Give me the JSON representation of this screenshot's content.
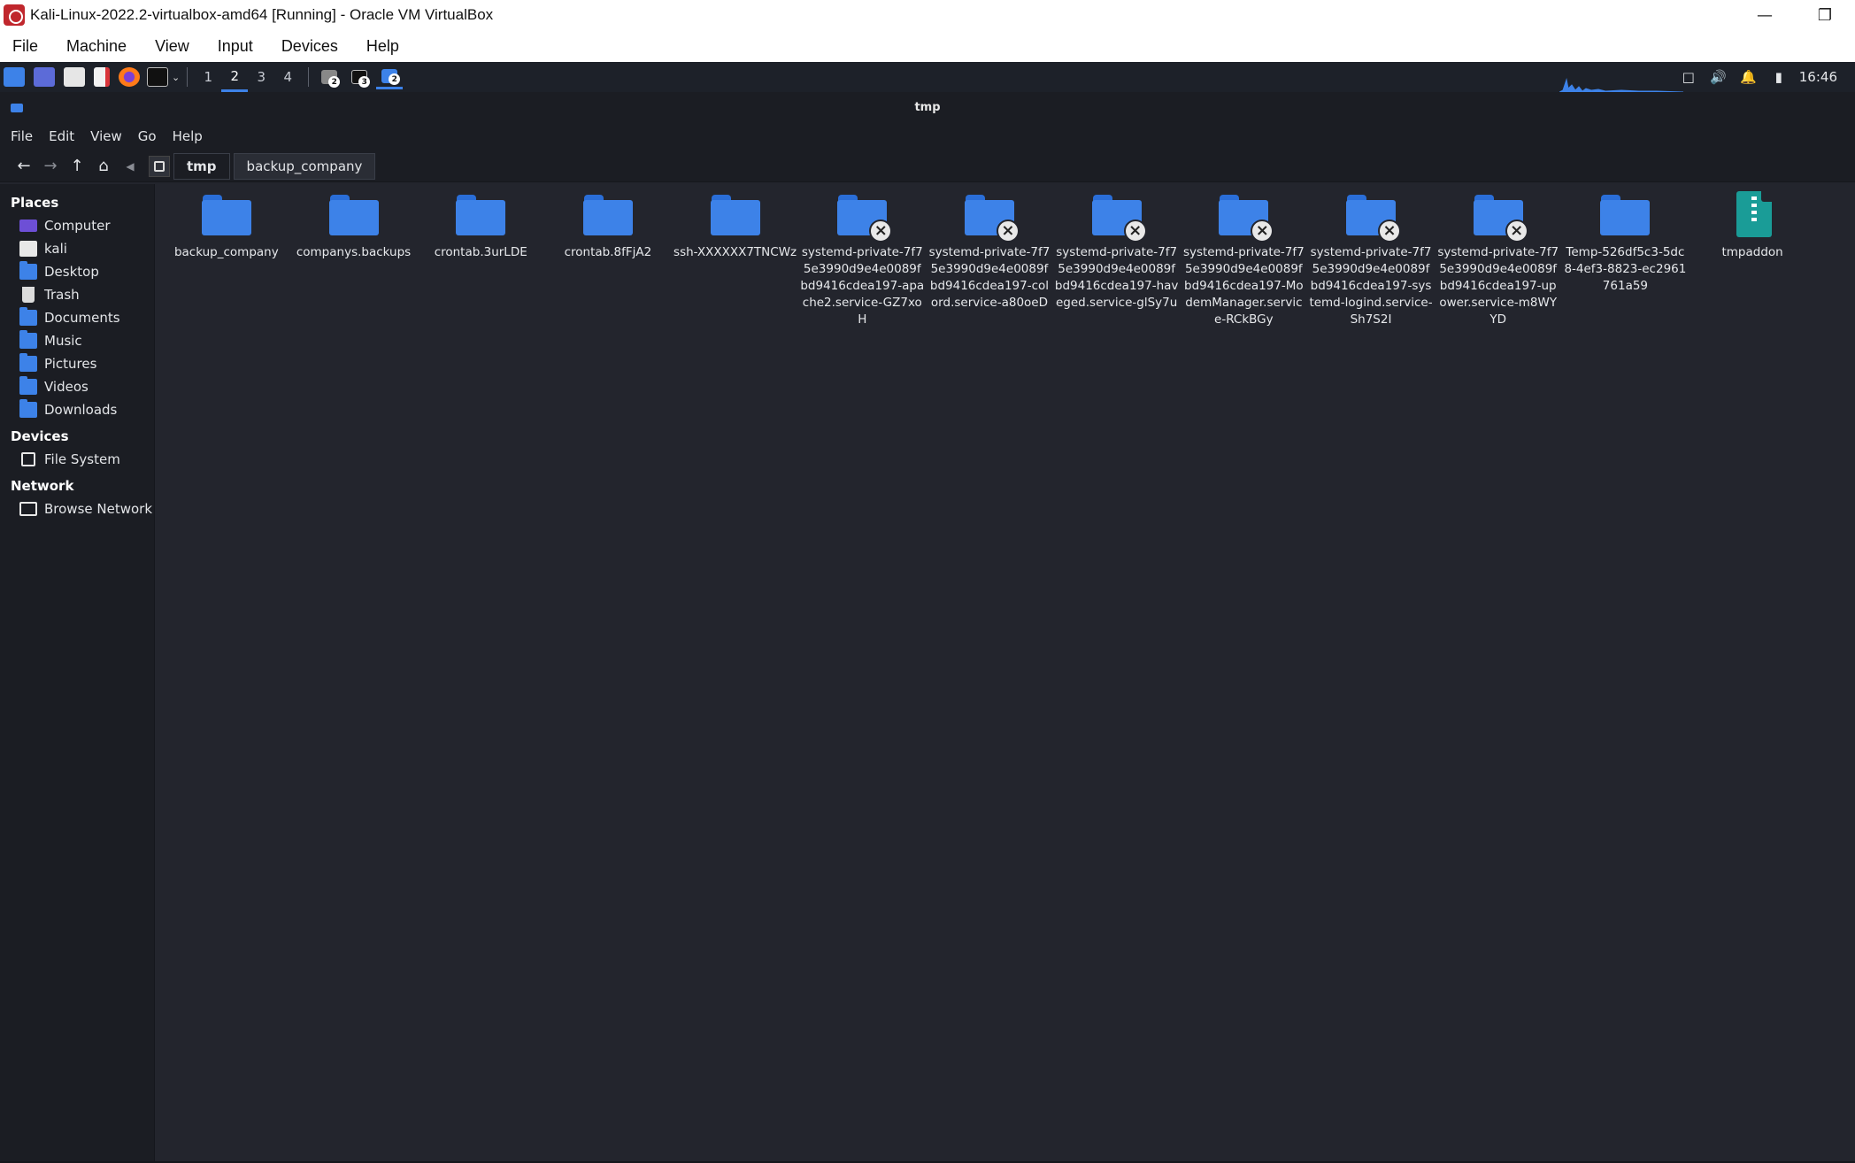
{
  "host": {
    "title": "Kali-Linux-2022.2-virtualbox-amd64 [Running] - Oracle VM VirtualBox",
    "menus": [
      "File",
      "Machine",
      "View",
      "Input",
      "Devices",
      "Help"
    ]
  },
  "panel": {
    "workspaces": [
      "1",
      "2",
      "3",
      "4"
    ],
    "active_workspace": "2",
    "task_badges": [
      "2",
      "3",
      "2"
    ],
    "clock": "16:46"
  },
  "window": {
    "title": "tmp",
    "menus": [
      "File",
      "Edit",
      "View",
      "Go",
      "Help"
    ],
    "breadcrumbs": [
      "tmp",
      "backup_company"
    ]
  },
  "sidebar": {
    "places_header": "Places",
    "places": [
      "Computer",
      "kali",
      "Desktop",
      "Trash",
      "Documents",
      "Music",
      "Pictures",
      "Videos",
      "Downloads"
    ],
    "devices_header": "Devices",
    "devices": [
      "File System"
    ],
    "network_header": "Network",
    "network": [
      "Browse Network"
    ]
  },
  "files": [
    {
      "name": "backup_company",
      "type": "folder"
    },
    {
      "name": "companys.backups",
      "type": "folder"
    },
    {
      "name": "crontab.3urLDE",
      "type": "folder"
    },
    {
      "name": "crontab.8fFjA2",
      "type": "folder"
    },
    {
      "name": "ssh-XXXXXX7TNCWz",
      "type": "folder"
    },
    {
      "name": "systemd-private-7f75e3990d9e4e0089fbd9416cdea197-apache2.service-GZ7xoH",
      "type": "folder-locked"
    },
    {
      "name": "systemd-private-7f75e3990d9e4e0089fbd9416cdea197-colord.service-a80oeD",
      "type": "folder-locked"
    },
    {
      "name": "systemd-private-7f75e3990d9e4e0089fbd9416cdea197-haveged.service-glSy7u",
      "type": "folder-locked"
    },
    {
      "name": "systemd-private-7f75e3990d9e4e0089fbd9416cdea197-ModemManager.service-RCkBGy",
      "type": "folder-locked"
    },
    {
      "name": "systemd-private-7f75e3990d9e4e0089fbd9416cdea197-systemd-logind.service-Sh7S2I",
      "type": "folder-locked"
    },
    {
      "name": "systemd-private-7f75e3990d9e4e0089fbd9416cdea197-upower.service-m8WYYD",
      "type": "folder-locked"
    },
    {
      "name": "Temp-526df5c3-5dc8-4ef3-8823-ec2961761a59",
      "type": "folder"
    },
    {
      "name": "tmpaddon",
      "type": "archive"
    }
  ],
  "colors": {
    "accent": "#3d82e8",
    "background": "#23252d",
    "sidebar": "#1b1d23"
  }
}
